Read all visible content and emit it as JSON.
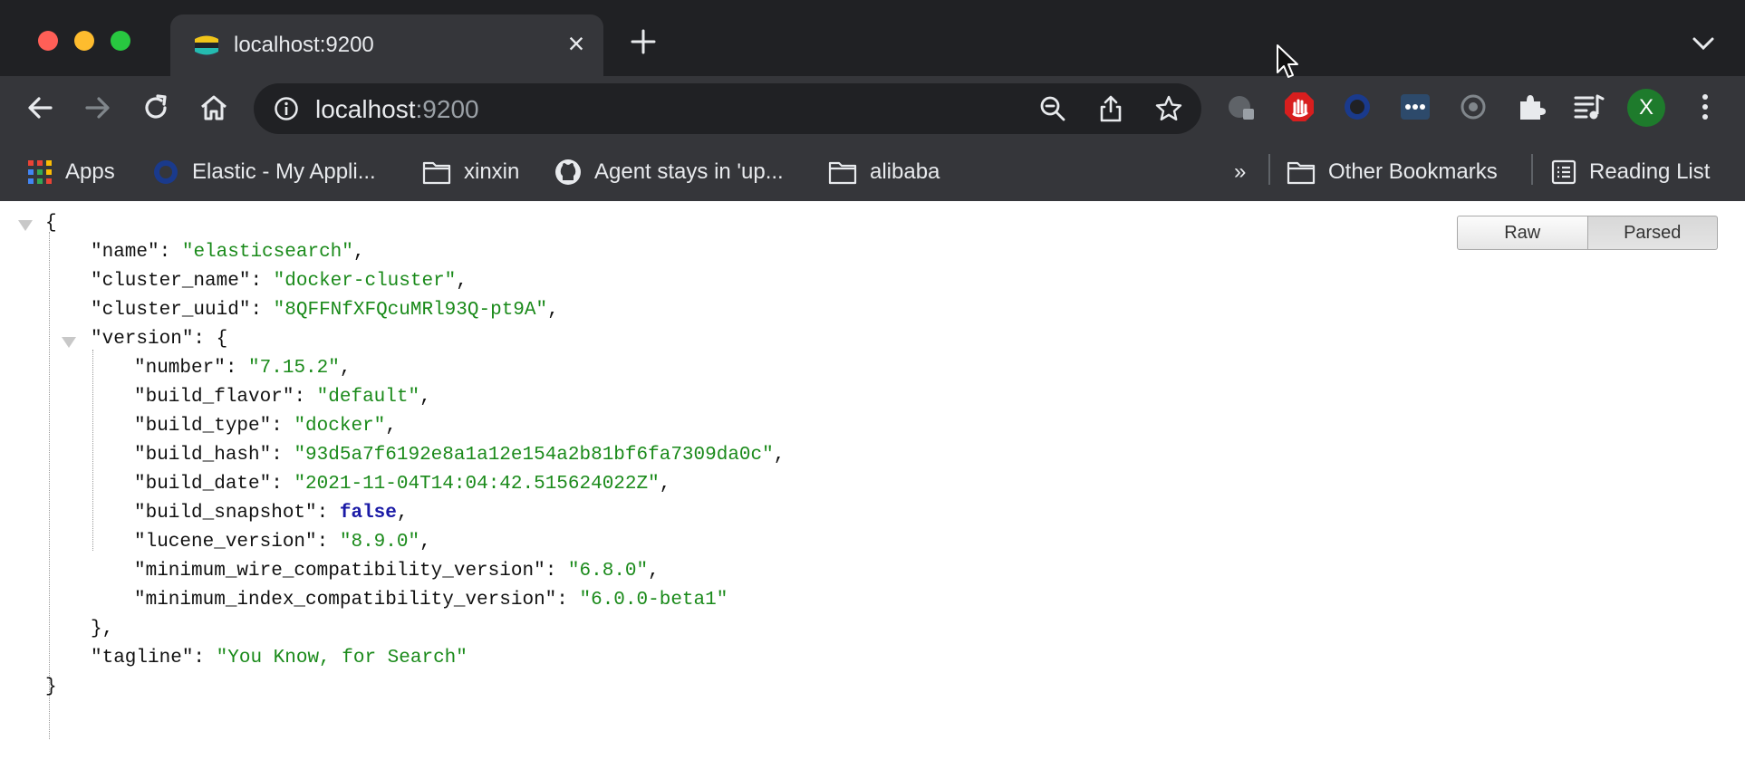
{
  "tab": {
    "title": "localhost:9200",
    "close_glyph": "×"
  },
  "address_bar": {
    "host": "localhost",
    "port": ":9200"
  },
  "profile": {
    "initial": "X",
    "color": "#1e7b2c"
  },
  "bookmarks": {
    "items": [
      {
        "label": "Apps",
        "icon": "apps-grid-icon"
      },
      {
        "label": "Elastic - My Appli...",
        "icon": "elastic-icon"
      },
      {
        "label": "xinxin",
        "icon": "folder-icon"
      },
      {
        "label": "Agent stays in 'up...",
        "icon": "github-icon"
      },
      {
        "label": "alibaba",
        "icon": "folder-icon"
      }
    ],
    "overflow": "»",
    "other": "Other Bookmarks",
    "reading_list": "Reading List"
  },
  "viewer": {
    "raw_label": "Raw",
    "parsed_label": "Parsed",
    "active": "Parsed"
  },
  "json": {
    "open_brace": "{",
    "close_brace": "}",
    "version_close": "},",
    "name_key": "\"name\"",
    "name_val": "\"elasticsearch\"",
    "cluster_name_key": "\"cluster_name\"",
    "cluster_name_val": "\"docker-cluster\"",
    "cluster_uuid_key": "\"cluster_uuid\"",
    "cluster_uuid_val": "\"8QFFNfXFQcuMRl93Q-pt9A\"",
    "version_key": "\"version\"",
    "number_key": "\"number\"",
    "number_val": "\"7.15.2\"",
    "build_flavor_key": "\"build_flavor\"",
    "build_flavor_val": "\"default\"",
    "build_type_key": "\"build_type\"",
    "build_type_val": "\"docker\"",
    "build_hash_key": "\"build_hash\"",
    "build_hash_val": "\"93d5a7f6192e8a1a12e154a2b81bf6fa7309da0c\"",
    "build_date_key": "\"build_date\"",
    "build_date_val": "\"2021-11-04T14:04:42.515624022Z\"",
    "build_snapshot_key": "\"build_snapshot\"",
    "build_snapshot_val": "false",
    "lucene_version_key": "\"lucene_version\"",
    "lucene_version_val": "\"8.9.0\"",
    "min_wire_key": "\"minimum_wire_compatibility_version\"",
    "min_wire_val": "\"6.8.0\"",
    "min_index_key": "\"minimum_index_compatibility_version\"",
    "min_index_val": "\"6.0.0-beta1\"",
    "tagline_key": "\"tagline\"",
    "tagline_val": "\"You Know, for Search\""
  },
  "colors": {
    "string": "#1a8a1a",
    "boolean": "#1a1aa6",
    "chrome_dark": "#202124",
    "chrome_toolbar": "#35363a"
  }
}
